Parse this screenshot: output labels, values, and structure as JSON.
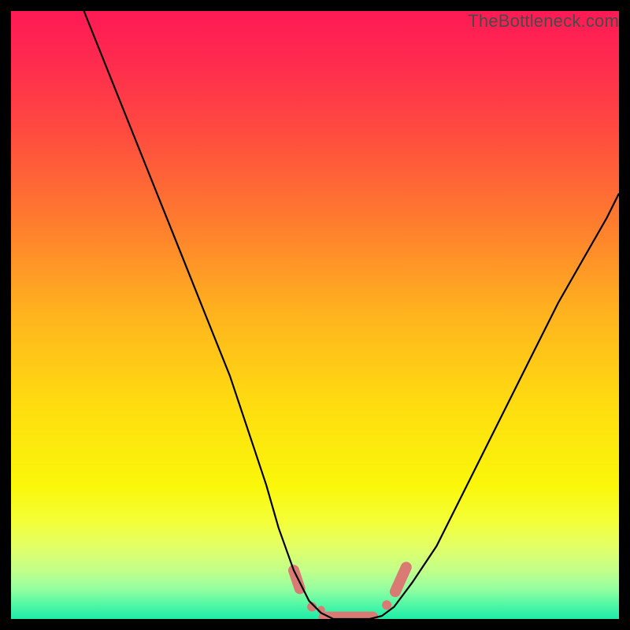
{
  "watermark": "TheBottleneck.com",
  "colors": {
    "background": "#000000",
    "gradient_stops": [
      {
        "offset": 0.0,
        "color": "#ff1a55"
      },
      {
        "offset": 0.08,
        "color": "#ff2a4f"
      },
      {
        "offset": 0.2,
        "color": "#ff4b3f"
      },
      {
        "offset": 0.35,
        "color": "#ff7d2e"
      },
      {
        "offset": 0.5,
        "color": "#ffb41e"
      },
      {
        "offset": 0.65,
        "color": "#ffdd10"
      },
      {
        "offset": 0.78,
        "color": "#faf70a"
      },
      {
        "offset": 0.84,
        "color": "#f4ff38"
      },
      {
        "offset": 0.88,
        "color": "#e4ff66"
      },
      {
        "offset": 0.92,
        "color": "#c2ff8a"
      },
      {
        "offset": 0.95,
        "color": "#95ffa0"
      },
      {
        "offset": 0.975,
        "color": "#55f8a5"
      },
      {
        "offset": 1.0,
        "color": "#1eeca8"
      }
    ],
    "curve": "#000000",
    "marker": "#d97a75"
  },
  "chart_data": {
    "type": "line",
    "title": "",
    "xlabel": "",
    "ylabel": "",
    "xlim": [
      0,
      100
    ],
    "ylim": [
      0,
      100
    ],
    "series": [
      {
        "name": "bottleneck-curve",
        "x": [
          12,
          16,
          20,
          24,
          28,
          32,
          36,
          40,
          42,
          44,
          46.5,
          49,
          51,
          53,
          55,
          57,
          59,
          61,
          63,
          66,
          70,
          74,
          78,
          82,
          86,
          90,
          94,
          98,
          100
        ],
        "y": [
          100,
          90,
          80,
          70,
          60,
          50,
          40,
          28,
          22,
          15,
          8,
          3,
          1,
          0,
          0,
          0,
          0,
          0.5,
          2,
          6,
          12,
          20,
          28,
          36,
          44,
          52,
          59,
          66,
          70
        ]
      }
    ],
    "markers": {
      "name": "highlighted-segment",
      "x": [
        46.5,
        48,
        49.5,
        51,
        52.5,
        54,
        55.5,
        57,
        58.5,
        60,
        61.5,
        63,
        64.5
      ],
      "y": [
        8,
        4,
        2,
        1,
        0,
        0,
        0,
        0,
        0.5,
        1.5,
        3,
        5,
        8
      ]
    }
  }
}
